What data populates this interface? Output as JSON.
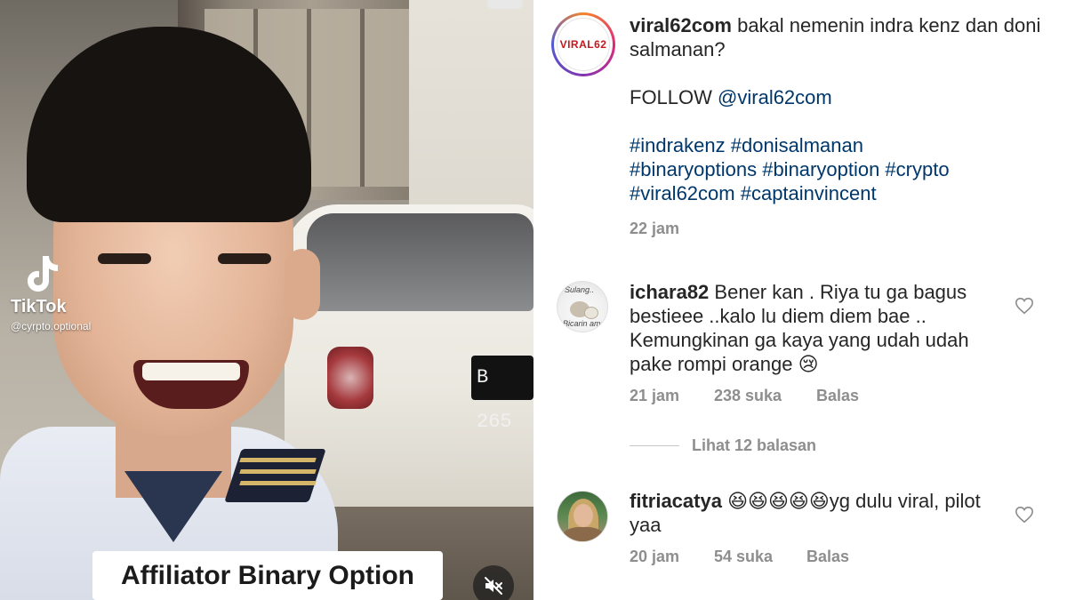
{
  "video": {
    "tiktok_brand": "TikTok",
    "tiktok_handle": "@cyrpto.optional",
    "plate_text": "B 265",
    "caption": "Affiliator Binary Option",
    "mute_icon": "speaker-muted-icon"
  },
  "post": {
    "username": "viral62com",
    "avatar_logo": "VIRAL62",
    "text": "bakal nemenin indra kenz dan doni salmanan?",
    "follow_prefix": "FOLLOW",
    "follow_handle": "@viral62com",
    "hashtags_line1": "#indrakenz #donisalmanan",
    "hashtags_line2": "#binaryoptions #binaryoption #crypto",
    "hashtags_line3": "#viral62com #captainvincent",
    "time": "22 jam"
  },
  "comments": [
    {
      "username": "ichara82",
      "text": "Bener kan . Riya tu ga bagus bestieee ..kalo lu diem diem bae .. Kemungkinan ga kaya yang udah udah pake rompi orange",
      "emoji": "😢",
      "avatar_text_top": "Sulang..",
      "avatar_text_bottom": "Bicarin ama",
      "time": "21 jam",
      "likes": "238 suka",
      "reply_label": "Balas",
      "view_replies": "Lihat 12 balasan"
    },
    {
      "username": "fitriacatya",
      "emoji": "😆😆😆😆😆",
      "text": "yg dulu viral, pilot yaa",
      "time": "20 jam",
      "likes": "54 suka",
      "reply_label": "Balas"
    }
  ],
  "colors": {
    "link": "#00376b",
    "muted": "#8e8e8e",
    "text": "#262626",
    "brand_red": "#c3181d"
  },
  "icons": {
    "like": "heart-outline-icon",
    "tiktok": "tiktok-note-icon"
  }
}
